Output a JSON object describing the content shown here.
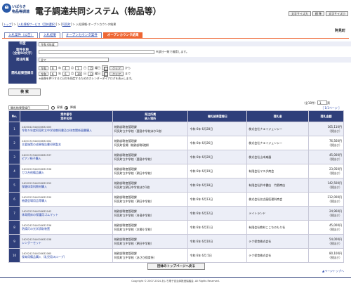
{
  "header": {
    "logo_line1": "いばらき",
    "logo_line2": "物品等調達",
    "title": "電子調達共同システム（物品等）",
    "buttons": [
      "文字サイズ大",
      "標 準",
      "文字サイズ小"
    ]
  },
  "breadcrumb": {
    "items": [
      "トップ",
      "入札情報サービス（団体選択）",
      "阿見町"
    ],
    "current": "入札情報-オープンカウンタ結果"
  },
  "org_name": "阿見町",
  "tabs": [
    "入札案件（公告）",
    "入札結果",
    "オープンカウンタ案件",
    "オープンカウンタ結果"
  ],
  "form": {
    "year_label": "年度",
    "year_value": "令和 6年度",
    "name_label": "案件名称\n（全角50文字）",
    "name_hint": "※部分一致で検索します。",
    "dept_label": "発注所属",
    "dept_value": "全て",
    "date_label": "開札結果登録日",
    "date_from": {
      "era": "令和",
      "y": "6",
      "m": "4",
      "d": "1",
      "year_unit": "年",
      "month_unit": "月",
      "day_unit": "日",
      "dow": "月",
      "dow_suffix": "曜日",
      "clear": "クリア",
      "suffix": "から"
    },
    "date_to": {
      "era": "令和",
      "y": "6",
      "m": "6",
      "d": "30",
      "year_unit": "年",
      "month_unit": "月",
      "day_unit": "日",
      "dow": "日",
      "dow_suffix": "曜日",
      "clear": "クリア",
      "suffix": "まで"
    },
    "date_hint": "※画像を押下すると日付を指定するためのカレンダーダイアログを表示します。",
    "search_button": "検 索"
  },
  "list_controls": {
    "sort_value": "開札結果登録日",
    "asc": "昇順",
    "desc": "降順",
    "count": "全10件",
    "count_page": "1",
    "page_unit": "頁",
    "pager": "［ 1/1ページ ］"
  },
  "table": {
    "headers": [
      "No.",
      "案件番号\n案件名称",
      "発注所属\n納入場所",
      "開札結果登録日",
      "落札者",
      "落札金額"
    ],
    "rows": [
      {
        "no": "1",
        "id": "2405042344000632005",
        "name": "令和５年度阿見町立中学校教科書及び体育関係図書購入",
        "dept": "総務部財産管理課",
        "place": "阿見町立中学校（鹿島中学校ほか1校）",
        "date": "令和 6年 6月28日",
        "winner": "株式会社ナエイジェンシー",
        "amt": "165,110円",
        "tax": "（税抜き）"
      },
      {
        "no": "2",
        "id": "2405172344000632002",
        "name": "主要施策の成果報告書印刷製本",
        "dept": "総務部財産管理課",
        "place": "阿見町役場（総務部財政課）",
        "date": "令和 6年 6月26日",
        "winner": "株式会社ナエイジェンシー",
        "amt": "76,560円",
        "tax": "（税抜き）"
      },
      {
        "no": "3",
        "id": "2405172344000632537",
        "name": "ピアノ椅子購入",
        "dept": "総務部財産管理課",
        "place": "阿見町立中学校（鹿島中学校）",
        "date": "令和 6年 6月20日",
        "winner": "株式会社山本楽器",
        "amt": "45,000円",
        "tax": "（税抜き）"
      },
      {
        "no": "4",
        "id": "2405222344000632536",
        "name": "ガス台他備品購入",
        "dept": "総務部財産管理課",
        "place": "阿見町立中学校（朝日中学校）",
        "date": "令和 6年 6月19日",
        "winner": "有限会社マスダ商会",
        "amt": "23,050円",
        "tax": "（税抜き）"
      },
      {
        "no": "5",
        "id": "2405222344000632252",
        "name": "保健体育科教材購入",
        "dept": "総務部財産管理課",
        "place": "阿見町立朝日中学校ほか1校",
        "date": "令和 6年 6月18日",
        "winner": "有限会社鈴木書店　竹野商店",
        "amt": "142,500円",
        "tax": "（税抜き）"
      },
      {
        "no": "6",
        "id": "2405222344000632530",
        "name": "抽選会場用品等購入",
        "dept": "総務部財産管理課",
        "place": "阿見町立中学校（朝日中学校）",
        "date": "令和 6年 6月13日",
        "winner": "株式会社名古屋医理科商会",
        "amt": "212,000円",
        "tax": "（税抜き）"
      },
      {
        "no": "7",
        "id": "2405222344000632042",
        "name": "体育館床の保護用ゴムマット",
        "dept": "総務部財産管理課",
        "place": "阿見町立中学校（舟島中学校）",
        "date": "令和 6年 6月12日",
        "winner": "メイトランド",
        "amt": "24,960円",
        "tax": "（税抜き）"
      },
      {
        "no": "8",
        "id": "2405242344000632536",
        "name": "防錆灯の光学読取装置",
        "dept": "総務部財産管理課",
        "place": "阿見町立中学校（本郷小学校）",
        "date": "令和 6年 6月11日",
        "winner": "有限会社教材ここちのもり社",
        "amt": "45,000円",
        "tax": "（税抜き）"
      },
      {
        "no": "9",
        "id": "2405242344000632038",
        "name": "シングーセット",
        "dept": "総務部財産管理課",
        "place": "阿見町立中学校（朝日中学校）",
        "date": "令和 6年 6月10日",
        "winner": "テク保育株式会社",
        "amt": "54,000円",
        "tax": "（税抜き）"
      },
      {
        "no": "10",
        "id": "2405242344000632065",
        "name": "保育用備品購入（乳児用スロープ）",
        "dept": "総務部財産管理課",
        "place": "阿見町立中学校（あさひ保育所）",
        "date": "令和 6年 6月 5日",
        "winner": "テク保育株式会社",
        "amt": "80,100円",
        "tax": "（税抜き）"
      }
    ]
  },
  "bottom_button": "団体のトップページへ戻る",
  "page_top": "▲ページトップへ",
  "copyright": "Copyright © 2007-2024 あいち電子自治体推進協議会. All Rights Reserved."
}
